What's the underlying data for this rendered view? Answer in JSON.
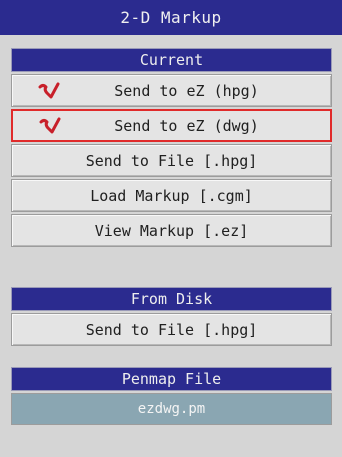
{
  "window": {
    "title": "2-D Markup"
  },
  "current": {
    "header": "Current",
    "buttons": [
      {
        "label": "Send to eZ (hpg)",
        "icon": "red-check-icon"
      },
      {
        "label": "Send to eZ (dwg)",
        "icon": "red-check-icon",
        "selected": true
      },
      {
        "label": "Send to File [.hpg]"
      },
      {
        "label": "Load Markup [.cgm]"
      },
      {
        "label": "View Markup [.ez]"
      }
    ]
  },
  "from_disk": {
    "header": "From Disk",
    "buttons": [
      {
        "label": "Send to File [.hpg]"
      }
    ]
  },
  "penmap": {
    "header": "Penmap File",
    "value": "ezdwg.pm"
  },
  "colors": {
    "header_bg": "#2b2b8f",
    "button_bg": "#e4e4e4",
    "selected_border": "#e02a2a",
    "icon": "#c8202a",
    "file_field_bg": "#8aa6b2"
  }
}
